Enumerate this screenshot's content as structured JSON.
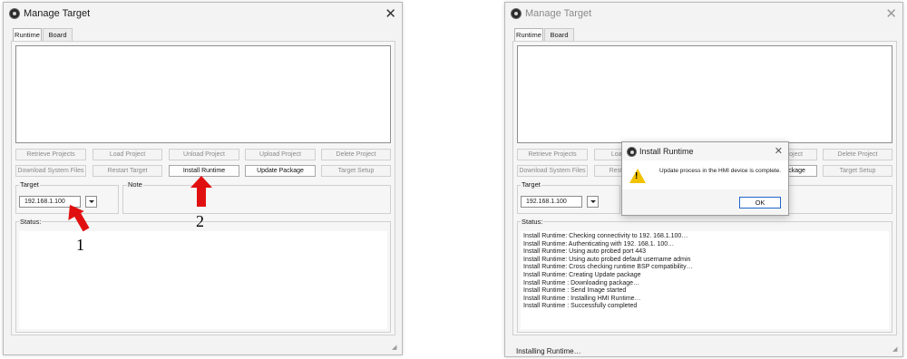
{
  "window": {
    "title": "Manage Target",
    "close_symbol": "✕"
  },
  "tabs": [
    "Runtime",
    "Board"
  ],
  "buttons": {
    "row1": [
      "Retrieve Projects",
      "Load Project",
      "Unload Project",
      "Upload Project",
      "Delete Project"
    ],
    "row2": [
      "Download System Files",
      "Restart Target",
      "Install Runtime",
      "Update Package",
      "Target Setup"
    ]
  },
  "target_group": {
    "label": "Target",
    "ip_value": "192.168.1.100"
  },
  "note_group": {
    "label": "Note"
  },
  "status": {
    "label": "Status:",
    "log": [
      "Install Runtime: Checking connectivity to 192. 168.1.100…",
      "Install Runtime: Authenticating with 192. 168.1. 100…",
      "Install Runtime: Using auto probed port 443",
      "Install Runtime: Using auto probed default username admin",
      "Install Runtime: Cross checking runtime BSP compatibility…",
      "Install Runtime: Creating Update package",
      "Install Runtime : Downloading package…",
      "Install Runtime : Send Image started",
      "Install Runtime : Installing HMI Runtime…",
      "Install Runtime : Successfully completed"
    ]
  },
  "statusbar": {
    "text": "Installing Runtime…"
  },
  "dialog": {
    "title": "Install Runtime",
    "message": "Update process in the HMI device is complete.",
    "ok_label": "OK",
    "icon": "warning-icon"
  },
  "annotations": {
    "step1": "1",
    "step2": "2",
    "arrow_color": "#e11010"
  }
}
